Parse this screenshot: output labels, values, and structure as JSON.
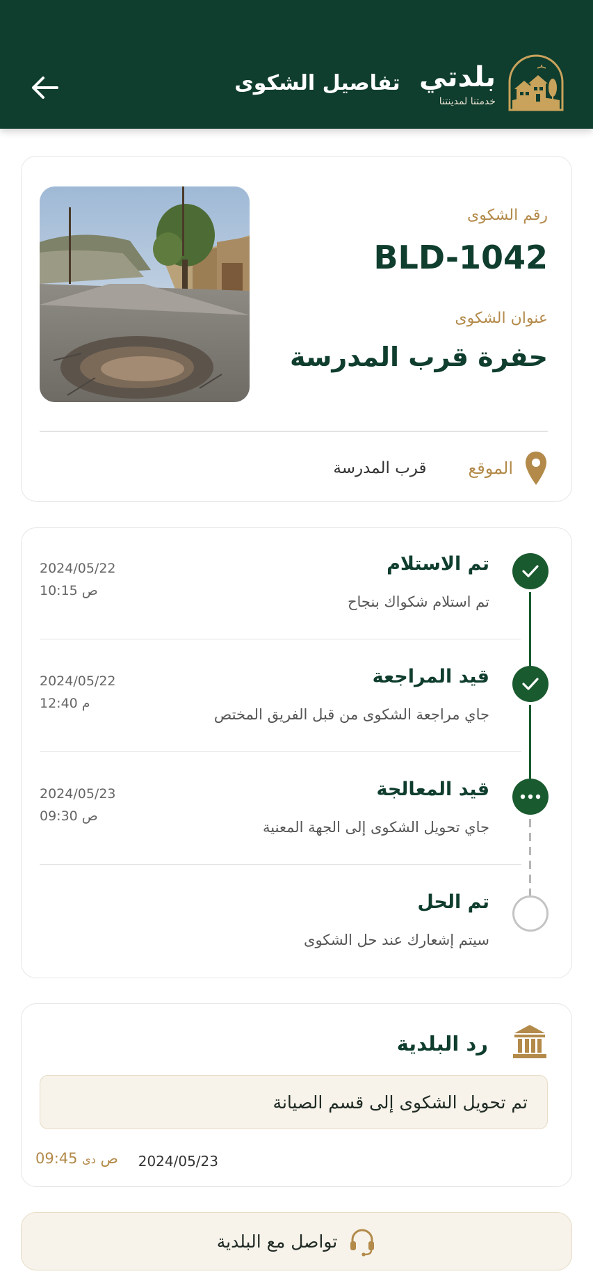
{
  "header": {
    "brand_name": "بلدتي",
    "brand_tagline": "خدمتنا لمدينتنا",
    "title": "تفاصيل الشكوى"
  },
  "complaint": {
    "number_label": "رقم الشكوى",
    "number": "BLD-1042",
    "title_label": "عنوان الشكوى",
    "title": "حفرة قرب المدرسة",
    "location_label": "الموقع",
    "location": "قرب المدرسة"
  },
  "timeline": [
    {
      "title": "تم الاستلام",
      "desc": "تم استلام شكواك بنجاح",
      "date": "2024/05/22",
      "time": "10:15 ص",
      "status": "done"
    },
    {
      "title": "قيد المراجعة",
      "desc": "جاي مراجعة الشكوى من قبل الفريق المختص",
      "date": "2024/05/22",
      "time": "12:40 م",
      "status": "done"
    },
    {
      "title": "قيد المعالجة",
      "desc": "جاي تحويل الشكوى إلى الجهة المعنية",
      "date": "2024/05/23",
      "time": "09:30 ص",
      "status": "in-progress"
    },
    {
      "title": "تم الحل",
      "desc": "سيتم إشعارك عند حل الشكوى",
      "date": "",
      "time": "",
      "status": "pending"
    }
  ],
  "reply": {
    "title": "رد البلدية",
    "message": "تم تحويل الشكوى إلى قسم الصيانة",
    "date": "2024/05/23",
    "time": "09:45 ص",
    "time_prefix": "دى"
  },
  "contact": {
    "label": "تواصل مع البلدية"
  },
  "colors": {
    "primary": "#0f3d2e",
    "accent": "#b38a4a",
    "step_done": "#1a5a2f",
    "cream": "#f7f3ea"
  }
}
